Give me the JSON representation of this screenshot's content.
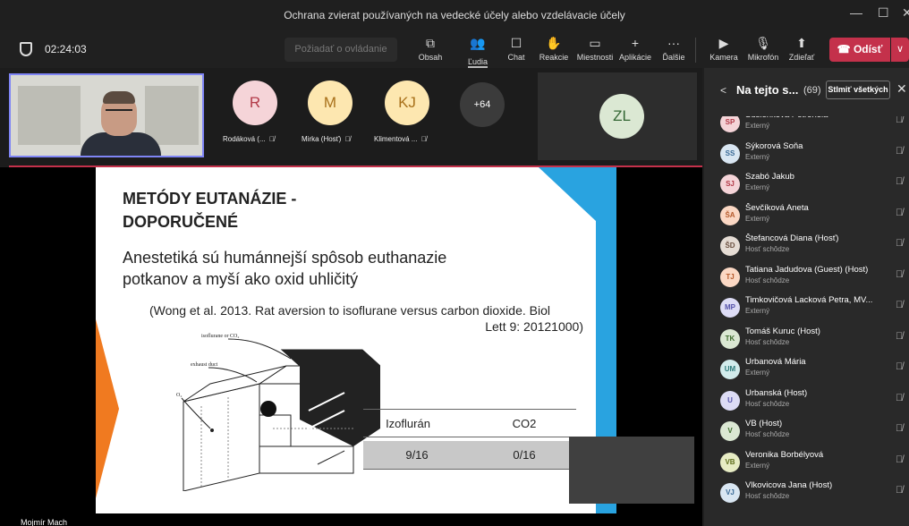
{
  "window": {
    "title": "Ochrana zvierat používaných na vedecké účely alebo vzdelávacie účely"
  },
  "toolbar": {
    "timer": "02:24:03",
    "request_control": "Požiadať o ovládanie",
    "buttons": [
      {
        "label": "Obsah",
        "icon": "share-content-icon",
        "glyph": "⧉"
      },
      {
        "label": "Ľudia",
        "icon": "people-icon",
        "glyph": "👥"
      },
      {
        "label": "Chat",
        "icon": "chat-icon",
        "glyph": "☐"
      },
      {
        "label": "Reakcie",
        "icon": "reactions-icon",
        "glyph": "✋"
      },
      {
        "label": "Miestnosti",
        "icon": "rooms-icon",
        "glyph": "▭"
      },
      {
        "label": "Aplikácie",
        "icon": "apps-icon",
        "glyph": "+"
      },
      {
        "label": "Ďalšie",
        "icon": "more-icon",
        "glyph": "···"
      }
    ],
    "media": [
      {
        "label": "Kamera",
        "icon": "camera-off-icon",
        "glyph": "▶"
      },
      {
        "label": "Mikrofón",
        "icon": "mic-off-icon",
        "glyph": "🎙"
      },
      {
        "label": "Zdieľať",
        "icon": "share-icon",
        "glyph": "⬆"
      }
    ],
    "leave": "Odísť",
    "leave_glyph": "☎",
    "dropdown_glyph": "∨"
  },
  "strip": {
    "tiles": [
      {
        "initials": "R",
        "name": "Rodáková (...",
        "bg": "#f5d4d8",
        "fg": "#b23a48"
      },
      {
        "initials": "M",
        "name": "Mirka (Hosť)",
        "bg": "#fde7b0",
        "fg": "#a8701a"
      },
      {
        "initials": "KJ",
        "name": "Klimentová ...",
        "bg": "#fde7b0",
        "fg": "#a8701a"
      }
    ],
    "more": "+64",
    "featured": {
      "initials": "ZL"
    }
  },
  "slide": {
    "title_line1": "METÓDY EUTANÁZIE -",
    "title_line2": "DOPORUČENÉ",
    "text_line1": "Anestetiká sú humánnejší spôsob euthanazie",
    "text_line2": "potkanov a myší ako oxid uhličitý",
    "cite_line1": "(Wong et al. 2013. Rat aversion to isoflurane versus carbon dioxide. Biol",
    "cite_line2": "Lett 9: 20121000)",
    "diagram_labels": {
      "iso": "isoflurane or CO₂",
      "exhaust": "exhaust duct",
      "o2": "O₂"
    },
    "table": {
      "headers": [
        "Izoflurán",
        "CO2"
      ],
      "row": [
        "9/16",
        "0/16"
      ]
    }
  },
  "presenter": "Mojmír Mach",
  "panel": {
    "title": "Na tejto s...",
    "count": "(69)",
    "mute_all": "Stlmiť všetkých",
    "people": [
      {
        "initials": "SP",
        "name": "Šusienková Petronela",
        "role": "Externý",
        "bg": "#f5d4d8",
        "fg": "#b23a48"
      },
      {
        "initials": "SS",
        "name": "Sýkorová Soňa",
        "role": "Externý",
        "bg": "#d9e6f2",
        "fg": "#3a6a96"
      },
      {
        "initials": "SJ",
        "name": "Szabó Jakub",
        "role": "Externý",
        "bg": "#f5d4d8",
        "fg": "#b23a48"
      },
      {
        "initials": "ŠA",
        "name": "Ševčíková Aneta",
        "role": "Externý",
        "bg": "#fbd8c4",
        "fg": "#b55a2c"
      },
      {
        "initials": "ŠD",
        "name": "Štefancová Diana (Hosť)",
        "role": "Hosť schôdze",
        "bg": "#e5dcd4",
        "fg": "#6b5040"
      },
      {
        "initials": "TJ",
        "name": "Tatiana Jadudova (Guest) (Host)",
        "role": "Hosť schôdze",
        "bg": "#fbd8c4",
        "fg": "#b55a2c"
      },
      {
        "initials": "MP",
        "name": "Timkovičová Lacková Petra, MV...",
        "role": "Externý",
        "bg": "#dddcf5",
        "fg": "#5451a8"
      },
      {
        "initials": "TK",
        "name": "Tomáš Kuruc (Host)",
        "role": "Hosť schôdze",
        "bg": "#dbe8d3",
        "fg": "#3d6b2c"
      },
      {
        "initials": "UM",
        "name": "Urbanová Mária",
        "role": "Externý",
        "bg": "#d2ecec",
        "fg": "#2c7a7a"
      },
      {
        "initials": "U",
        "name": "Urbanská (Host)",
        "role": "Hosť schôdze",
        "bg": "#dddcf5",
        "fg": "#5451a8"
      },
      {
        "initials": "V",
        "name": "VB (Host)",
        "role": "Hosť schôdze",
        "bg": "#dbe8d3",
        "fg": "#3d6b2c"
      },
      {
        "initials": "VB",
        "name": "Veronika Borbélyová",
        "role": "Externý",
        "bg": "#e7ecc4",
        "fg": "#5f6e1c"
      },
      {
        "initials": "VJ",
        "name": "Vlkovicova Jana (Host)",
        "role": "Hosť schôdze",
        "bg": "#d9e6f2",
        "fg": "#3a6a96"
      }
    ]
  }
}
